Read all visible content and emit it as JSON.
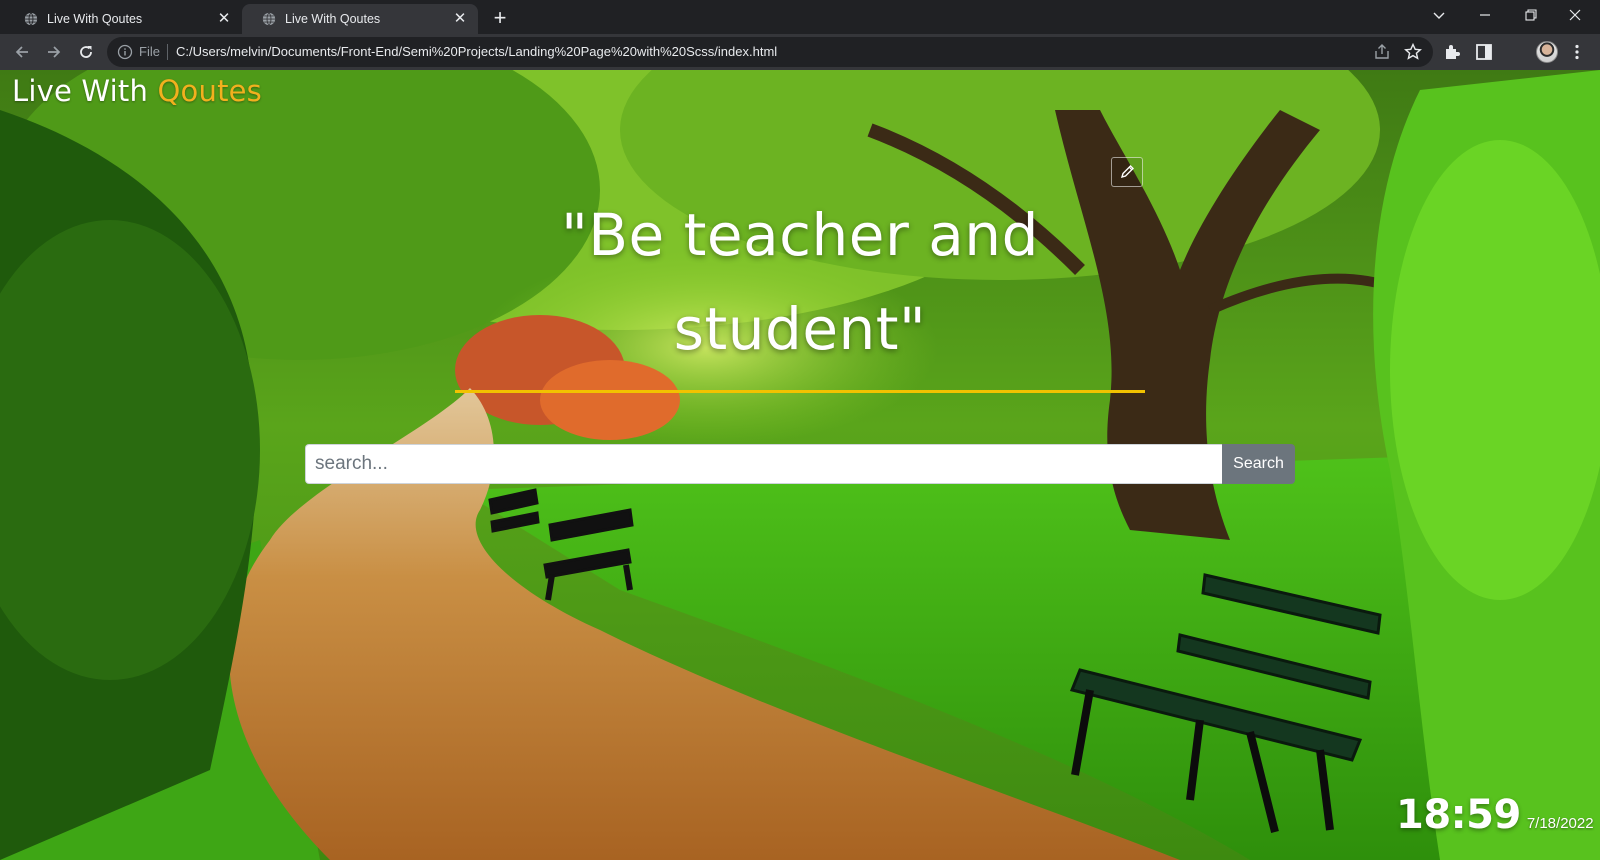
{
  "browser": {
    "tabs": [
      {
        "title": "Live With Qoutes",
        "active": false
      },
      {
        "title": "Live With Qoutes",
        "active": true
      }
    ],
    "address": {
      "scheme_label": "File",
      "url": "C:/Users/melvin/Documents/Front-End/Semi%20Projects/Landing%20Page%20with%20Scss/index.html"
    }
  },
  "page": {
    "brand": {
      "main": "Live With",
      "accent": "Qoutes"
    },
    "quote": "\"Be teacher and student\"",
    "search": {
      "placeholder": "search...",
      "value": "",
      "button_label": "Search"
    },
    "clock": {
      "time": "18:59",
      "date": "7/18/2022"
    }
  },
  "colors": {
    "accent": "#f2b01e",
    "underline": "#f2c200",
    "search_button": "#6c757d",
    "chrome_dark": "#202124",
    "chrome_toolbar": "#35363a"
  },
  "icons": {
    "tab_favicon": "globe-icon",
    "edit": "pencil-icon",
    "nav": [
      "back-arrow-icon",
      "forward-arrow-icon",
      "reload-icon"
    ],
    "toolbar": [
      "share-icon",
      "star-icon",
      "extensions-icon",
      "sidepanel-icon",
      "profile-avatar",
      "menu-dots-icon"
    ]
  }
}
